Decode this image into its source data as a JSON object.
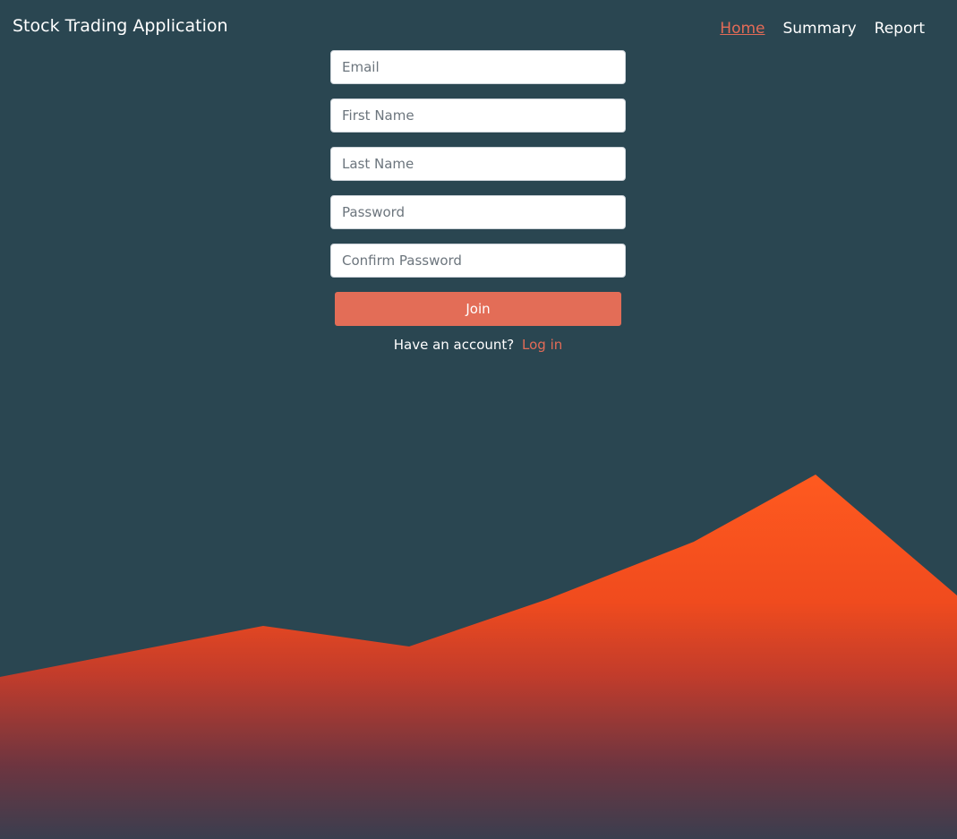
{
  "app": {
    "title": "Stock Trading Application"
  },
  "nav": {
    "items": [
      {
        "label": "Home",
        "active": true
      },
      {
        "label": "Summary",
        "active": false
      },
      {
        "label": "Report",
        "active": false
      }
    ]
  },
  "form": {
    "email_placeholder": "Email",
    "first_name_placeholder": "First Name",
    "last_name_placeholder": "Last Name",
    "password_placeholder": "Password",
    "confirm_password_placeholder": "Confirm Password",
    "join_label": "Join",
    "account_prompt": "Have an account?",
    "login_label": "Log in"
  },
  "colors": {
    "background": "#2a4651",
    "accent": "#e36d57",
    "mountain_top": "#ff5a1f",
    "mountain_bottom": "#3a3e4f"
  }
}
